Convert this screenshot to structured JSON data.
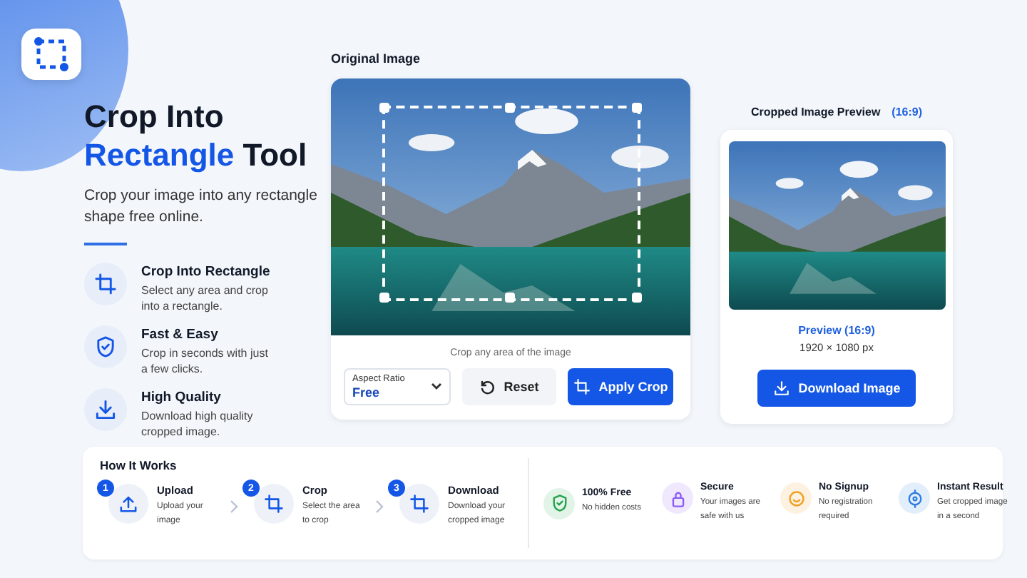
{
  "hero": {
    "title_line1": "Crop Into",
    "title_highlight": "Rectangle",
    "title_rest": "Tool",
    "subtitle": "Crop your image into any rectangle shape free online."
  },
  "features": [
    {
      "kind": "crop",
      "title": "Crop Into Rectangle",
      "text": "Select any area and crop into a rectangle."
    },
    {
      "kind": "shield",
      "title": "Fast & Easy",
      "text": "Crop in seconds with just a few clicks."
    },
    {
      "kind": "download",
      "title": "High Quality",
      "text": "Download high quality cropped image."
    }
  ],
  "editor": {
    "label": "Original Image",
    "hint": "Crop any area of the image",
    "aspect_ratio": {
      "label": "Aspect Ratio",
      "value": "Free"
    },
    "reset": "Reset",
    "apply": "Apply Crop"
  },
  "preview": {
    "label": "Cropped Image Preview",
    "ratio": "(16:9)",
    "caption": "Preview (16:9)",
    "size": "1920 × 1080 px",
    "download": "Download Image"
  },
  "how_it_works": {
    "title": "How It Works",
    "steps": [
      {
        "number": "1",
        "kind": "upload",
        "title": "Upload",
        "text": "Upload your image"
      },
      {
        "number": "2",
        "kind": "crop",
        "title": "Crop",
        "text": "Select the area to crop"
      },
      {
        "number": "3",
        "kind": "crop",
        "title": "Download",
        "text": "Download your cropped image"
      }
    ]
  },
  "perks": [
    {
      "kind": "shield",
      "color": "#22a34a",
      "title": "100% Free",
      "text": "No hidden costs"
    },
    {
      "kind": "lock",
      "color": "#8b5cf6",
      "title": "Secure",
      "text": "Your images are safe with us"
    },
    {
      "kind": "smile",
      "color": "#f0a020",
      "title": "No Signup",
      "text": "No registration required"
    },
    {
      "kind": "target",
      "color": "#2f7de1",
      "title": "Instant Result",
      "text": "Get cropped image in a second"
    }
  ]
}
